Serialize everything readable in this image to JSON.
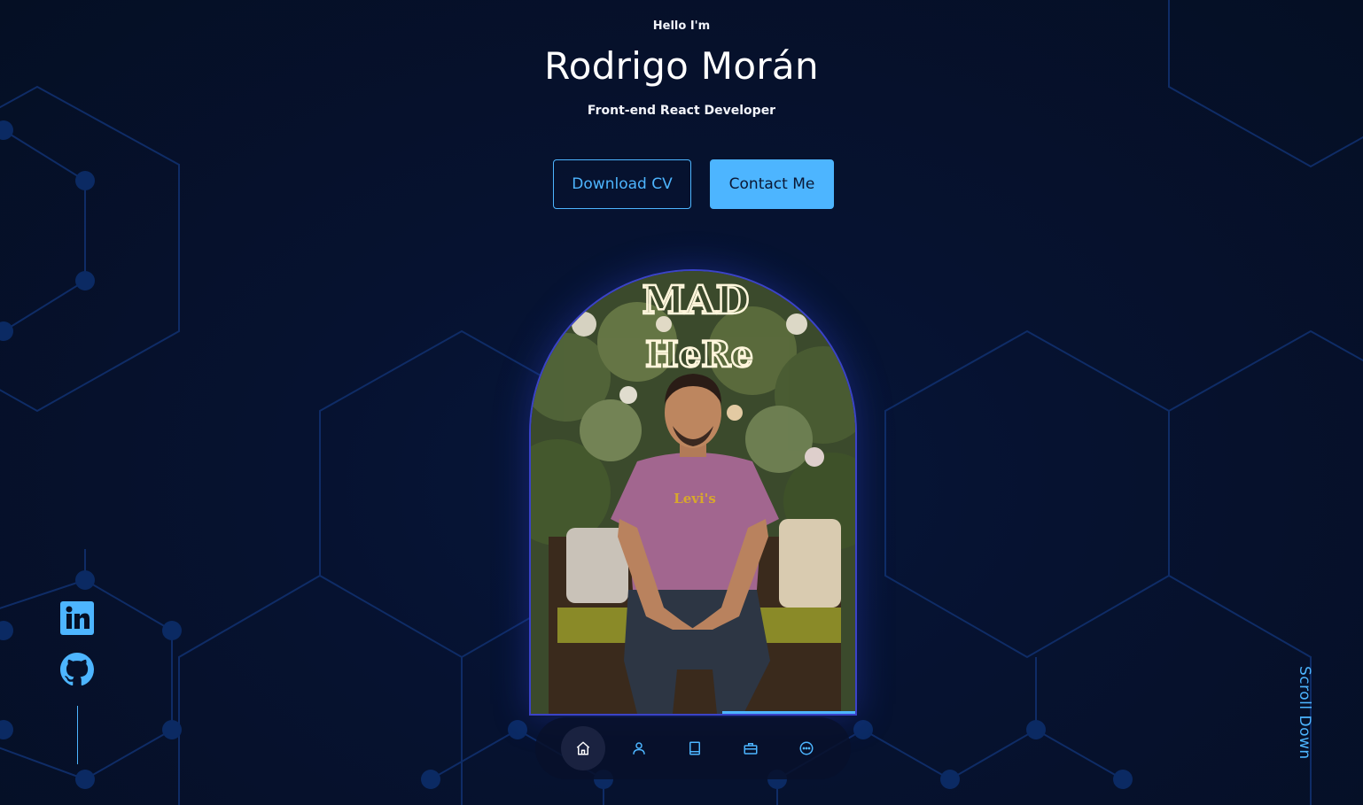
{
  "header": {
    "greeting": "Hello I'm",
    "name": "Rodrigo Morán",
    "role": "Front-end React Developer"
  },
  "actions": {
    "download_cv_label": "Download CV",
    "contact_label": "Contact Me"
  },
  "portrait": {
    "sign_text_line1": "MAD",
    "sign_text_line2": "HeRe",
    "shirt_text": "Levi's"
  },
  "nav": {
    "items": [
      {
        "icon": "home-icon",
        "active": true
      },
      {
        "icon": "user-icon",
        "active": false
      },
      {
        "icon": "book-icon",
        "active": false
      },
      {
        "icon": "briefcase-icon",
        "active": false
      },
      {
        "icon": "message-icon",
        "active": false
      }
    ]
  },
  "socials": {
    "items": [
      {
        "icon": "linkedin-icon"
      },
      {
        "icon": "github-icon"
      }
    ]
  },
  "scroll": {
    "label": "Scroll Down"
  },
  "colors": {
    "background": "#050f24",
    "accent": "#4db5ff",
    "pattern": "#0f2c66",
    "frame": "#3b43c8"
  }
}
